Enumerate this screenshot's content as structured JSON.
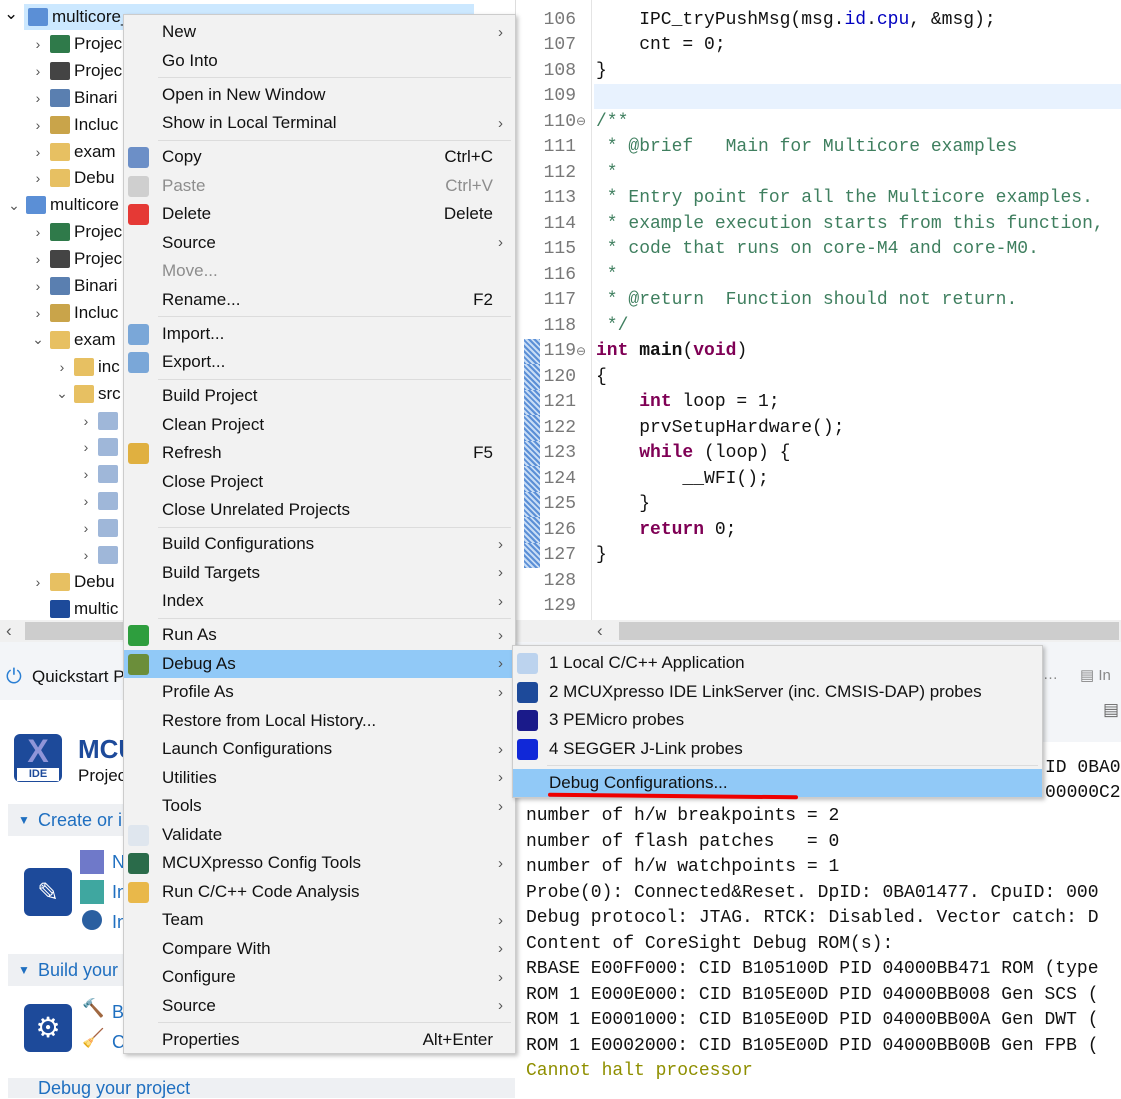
{
  "explorer": {
    "rows": [
      {
        "label": "multicore_",
        "depth": 0,
        "exp": "v",
        "icon": "c-project-folder-icon",
        "color": "#5b8fd6",
        "sel": true
      },
      {
        "label": "Projec",
        "depth": 1,
        "exp": ">",
        "icon": "project-settings-icon",
        "color": "#2f7a4a"
      },
      {
        "label": "Projec",
        "depth": 1,
        "exp": ">",
        "icon": "chip-icon",
        "color": "#444"
      },
      {
        "label": "Binari",
        "depth": 1,
        "exp": ">",
        "icon": "binaries-icon",
        "color": "#5a7fb0"
      },
      {
        "label": "Incluc",
        "depth": 1,
        "exp": ">",
        "icon": "includes-icon",
        "color": "#c9a44a"
      },
      {
        "label": "exam",
        "depth": 1,
        "exp": ">",
        "icon": "source-folder-icon",
        "color": "#e7c062"
      },
      {
        "label": "Debu",
        "depth": 1,
        "exp": ">",
        "icon": "folder-icon",
        "color": "#e7c062"
      },
      {
        "label": "multicore",
        "depth": 0,
        "exp": "v",
        "icon": "c-project-folder-icon",
        "color": "#5b8fd6"
      },
      {
        "label": "Projec",
        "depth": 1,
        "exp": ">",
        "icon": "project-settings-icon",
        "color": "#2f7a4a"
      },
      {
        "label": "Projec",
        "depth": 1,
        "exp": ">",
        "icon": "chip-icon",
        "color": "#444"
      },
      {
        "label": "Binari",
        "depth": 1,
        "exp": ">",
        "icon": "binaries-icon",
        "color": "#5a7fb0"
      },
      {
        "label": "Incluc",
        "depth": 1,
        "exp": ">",
        "icon": "includes-icon",
        "color": "#c9a44a"
      },
      {
        "label": "exam",
        "depth": 1,
        "exp": "v",
        "icon": "source-folder-icon",
        "color": "#e7c062"
      },
      {
        "label": "inc",
        "depth": 2,
        "exp": ">",
        "icon": "folder-icon",
        "color": "#e7c062"
      },
      {
        "label": "src",
        "depth": 2,
        "exp": "v",
        "icon": "folder-icon",
        "color": "#e7c062"
      },
      {
        "label": "",
        "depth": 3,
        "exp": ">",
        "icon": "c-file-icon",
        "color": "#9fb7d9"
      },
      {
        "label": "",
        "depth": 3,
        "exp": ">",
        "icon": "c-file-icon",
        "color": "#9fb7d9"
      },
      {
        "label": "",
        "depth": 3,
        "exp": ">",
        "icon": "c-file-icon",
        "color": "#9fb7d9"
      },
      {
        "label": "",
        "depth": 3,
        "exp": ">",
        "icon": "c-file-icon",
        "color": "#9fb7d9"
      },
      {
        "label": "",
        "depth": 3,
        "exp": ">",
        "icon": "c-file-icon",
        "color": "#9fb7d9"
      },
      {
        "label": "",
        "depth": 3,
        "exp": ">",
        "icon": "c-file-icon",
        "color": "#9fb7d9"
      },
      {
        "label": "Debu",
        "depth": 1,
        "exp": ">",
        "icon": "folder-icon",
        "color": "#e7c062"
      },
      {
        "label": "multic",
        "depth": 1,
        "exp": "",
        "icon": "linkserver-icon",
        "color": "#1d4a9a"
      }
    ]
  },
  "editor": {
    "lines": [
      {
        "n": "106",
        "html": "    IPC_tryPushMsg(msg.<span class='fld'>id</span>.<span class='fld'>cpu</span>, &amp;msg);"
      },
      {
        "n": "107",
        "html": "    cnt = 0;"
      },
      {
        "n": "108",
        "html": "}"
      },
      {
        "n": "109",
        "html": "",
        "hl": true
      },
      {
        "n": "110",
        "html": "<span class='cm'>/**</span>",
        "fold": true
      },
      {
        "n": "111",
        "html": "<span class='cm'> * @brief   Main for Multicore examples</span>"
      },
      {
        "n": "112",
        "html": "<span class='cm'> *</span>"
      },
      {
        "n": "113",
        "html": "<span class='cm'> * Entry point for all the Multicore examples.</span>"
      },
      {
        "n": "114",
        "html": "<span class='cm'> * example execution starts from this function,</span>"
      },
      {
        "n": "115",
        "html": "<span class='cm'> * code that runs on core-M4 and core-M0.</span>"
      },
      {
        "n": "116",
        "html": "<span class='cm'> *</span>"
      },
      {
        "n": "117",
        "html": "<span class='cm'> * @return  Function should not return.</span>"
      },
      {
        "n": "118",
        "html": "<span class='cm'> */</span>"
      },
      {
        "n": "119",
        "html": "<span class='kw'>int</span> <b>main</b>(<span class='kw'>void</span>)",
        "fold": true,
        "mark": true
      },
      {
        "n": "120",
        "html": "{",
        "mark": true
      },
      {
        "n": "121",
        "html": "    <span class='kw'>int</span> loop = 1;",
        "mark": true
      },
      {
        "n": "122",
        "html": "    prvSetupHardware();",
        "mark": true
      },
      {
        "n": "123",
        "html": "    <span class='kw'>while</span> (loop) {",
        "mark": true
      },
      {
        "n": "124",
        "html": "        __WFI();",
        "mark": true
      },
      {
        "n": "125",
        "html": "    }",
        "mark": true
      },
      {
        "n": "126",
        "html": "    <span class='kw'>return</span> 0;",
        "mark": true
      },
      {
        "n": "127",
        "html": "}",
        "mark": true
      },
      {
        "n": "128",
        "html": ""
      },
      {
        "n": "129",
        "html": ""
      }
    ]
  },
  "quickstart": {
    "tab": "Quickstart P",
    "title": "MCU",
    "subtitle": "Projec",
    "create": "Create or i",
    "create_items": [
      "N",
      "In",
      "In"
    ],
    "build": "Build your",
    "build_items": [
      "B",
      "C"
    ],
    "debug": "Debug your project"
  },
  "console": {
    "partial_top": [
      "ID 0BA0",
      "00000C2"
    ],
    "lines": [
      "number of h/w breakpoints = 2",
      "number of flash patches   = 0",
      "number of h/w watchpoints = 1",
      "Probe(0): Connected&Reset. DpID: 0BA01477. CpuID: 000",
      "Debug protocol: JTAG. RTCK: Disabled. Vector catch: D",
      "Content of CoreSight Debug ROM(s):",
      "RBASE E00FF000: CID B105100D PID 04000BB471 ROM (type",
      "ROM 1 E000E000: CID B105E00D PID 04000BB008 Gen SCS (",
      "ROM 1 E0001000: CID B105E00D PID 04000BB00A Gen DWT (",
      "ROM 1 E0002000: CID B105E00D PID 04000BB00B Gen FPB ("
    ],
    "error": "Cannot halt processor",
    "error_color": "#8f8f00"
  },
  "menu": {
    "items": [
      {
        "label": "New",
        "sub": true
      },
      {
        "label": "Go Into"
      },
      {
        "sep": true
      },
      {
        "label": "Open in New Window"
      },
      {
        "label": "Show in Local Terminal",
        "sub": true
      },
      {
        "sep": true
      },
      {
        "label": "Copy",
        "sc": "Ctrl+C",
        "icon": "copy-icon",
        "color": "#6c8fc7"
      },
      {
        "label": "Paste",
        "sc": "Ctrl+V",
        "dis": true,
        "icon": "paste-icon",
        "color": "#cfcfcf"
      },
      {
        "label": "Delete",
        "sc": "Delete",
        "icon": "delete-icon",
        "color": "#e53935"
      },
      {
        "label": "Source",
        "sub": true
      },
      {
        "label": "Move...",
        "dis": true
      },
      {
        "label": "Rename...",
        "sc": "F2"
      },
      {
        "sep": true
      },
      {
        "label": "Import...",
        "icon": "import-icon",
        "color": "#7aa7d8"
      },
      {
        "label": "Export...",
        "icon": "export-icon",
        "color": "#7aa7d8"
      },
      {
        "sep": true
      },
      {
        "label": "Build Project"
      },
      {
        "label": "Clean Project"
      },
      {
        "label": "Refresh",
        "sc": "F5",
        "icon": "refresh-icon",
        "color": "#e0b040"
      },
      {
        "label": "Close Project"
      },
      {
        "label": "Close Unrelated Projects"
      },
      {
        "sep": true
      },
      {
        "label": "Build Configurations",
        "sub": true
      },
      {
        "label": "Build Targets",
        "sub": true
      },
      {
        "label": "Index",
        "sub": true
      },
      {
        "sep": true
      },
      {
        "label": "Run As",
        "sub": true,
        "icon": "run-icon",
        "color": "#2e9e3e"
      },
      {
        "label": "Debug As",
        "sub": true,
        "hl": true,
        "icon": "bug-icon",
        "color": "#6b8e3a"
      },
      {
        "label": "Profile As",
        "sub": true
      },
      {
        "label": "Restore from Local History..."
      },
      {
        "label": "Launch Configurations",
        "sub": true
      },
      {
        "label": "Utilities",
        "sub": true
      },
      {
        "label": "Tools",
        "sub": true
      },
      {
        "label": "Validate",
        "icon": "checkbox-icon",
        "color": "#dfe6ee"
      },
      {
        "label": "MCUXpresso Config Tools",
        "sub": true,
        "icon": "config-tools-icon",
        "color": "#2a6b4a"
      },
      {
        "label": "Run C/C++ Code Analysis",
        "icon": "code-analysis-icon",
        "color": "#e9b84a"
      },
      {
        "label": "Team",
        "sub": true
      },
      {
        "label": "Compare With",
        "sub": true
      },
      {
        "label": "Configure",
        "sub": true
      },
      {
        "label": "Source",
        "sub": true
      },
      {
        "sep": true
      },
      {
        "label": "Properties",
        "sc": "Alt+Enter"
      }
    ]
  },
  "submenu": {
    "items": [
      {
        "label": "1 Local C/C++ Application",
        "icon": "c-app-icon",
        "color": "#bcd3ee"
      },
      {
        "label": "2 MCUXpresso IDE LinkServer (inc. CMSIS-DAP) probes",
        "icon": "linkserver-icon",
        "color": "#1d4a9a"
      },
      {
        "label": "3 PEMicro probes",
        "icon": "pemicro-icon",
        "color": "#1a1a8a"
      },
      {
        "label": "4 SEGGER J-Link probes",
        "icon": "jlink-icon",
        "color": "#1028d8"
      },
      {
        "sep": true
      },
      {
        "label": "Debug Configurations...",
        "hl": true
      }
    ]
  },
  "colors": {
    "highlight": "#91c9f7",
    "annotation": "#e00000"
  }
}
